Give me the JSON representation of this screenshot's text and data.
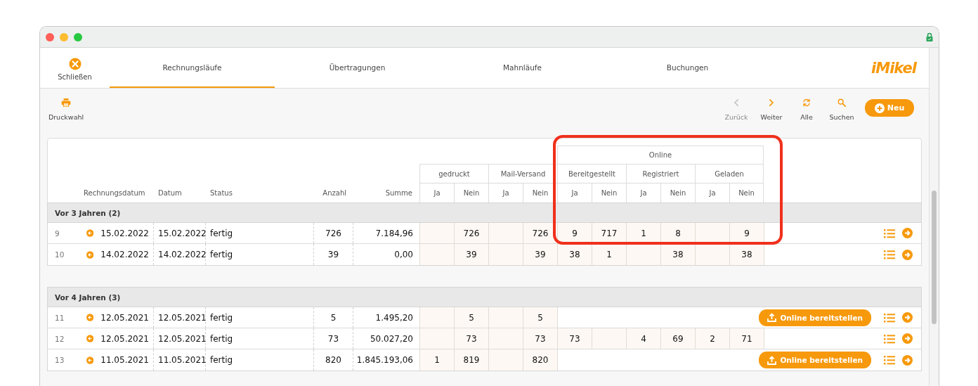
{
  "close": {
    "label": "Schließen"
  },
  "tabs": [
    {
      "label": "Rechnungsläufe",
      "selected": true
    },
    {
      "label": "Übertragungen",
      "selected": false
    },
    {
      "label": "Mahnläufe",
      "selected": false
    },
    {
      "label": "Buchungen",
      "selected": false
    }
  ],
  "logo": "iMikel",
  "toolbar": {
    "left": [
      {
        "kind": "print",
        "label": "Druckwahl"
      }
    ],
    "right": [
      {
        "kind": "back",
        "label": "Zurück",
        "disabled": true
      },
      {
        "kind": "forward",
        "label": "Weiter",
        "disabled": false
      },
      {
        "kind": "refresh",
        "label": "Alle",
        "disabled": false
      },
      {
        "kind": "search",
        "label": "Suchen",
        "disabled": false
      }
    ],
    "new_button": "Neu"
  },
  "table": {
    "columns": [
      "Rechnungsdatum",
      "Datum",
      "Status",
      "Anzahl",
      "Summe"
    ],
    "channels": [
      {
        "label": "gedruckt",
        "sub": [
          "Ja",
          "Nein"
        ]
      },
      {
        "label": "Mail-Versand",
        "sub": [
          "Ja",
          "Nein"
        ]
      }
    ],
    "online": {
      "label": "Online",
      "groups": [
        {
          "label": "Bereitgestellt",
          "sub": [
            "Ja",
            "Nein"
          ]
        },
        {
          "label": "Registriert",
          "sub": [
            "Ja",
            "Nein"
          ]
        },
        {
          "label": "Geladen",
          "sub": [
            "Ja",
            "Nein"
          ]
        }
      ]
    },
    "groups": [
      {
        "title": "Vor 3 Jahren (2)",
        "rows": [
          {
            "number": "9",
            "invoice_date": "15.02.2022",
            "date": "15.02.2022",
            "status": "fertig",
            "count": "726",
            "sum": "7.184,96",
            "kind": "online",
            "printed": {
              "no": "726"
            },
            "mail": {
              "no": "726"
            },
            "provided": {
              "yes": "9",
              "no": "717"
            },
            "registered": {
              "yes": "1",
              "no": "8"
            },
            "loaded": {
              "no": "9"
            }
          },
          {
            "number": "10",
            "invoice_date": "14.02.2022",
            "date": "14.02.2022",
            "status": "fertig",
            "count": "39",
            "sum": "0,00",
            "kind": "online",
            "printed": {
              "no": "39"
            },
            "mail": {
              "no": "39"
            },
            "provided": {
              "yes": "38",
              "no": "1"
            },
            "registered": {
              "no": "38"
            },
            "loaded": {
              "no": "38"
            }
          }
        ]
      },
      {
        "title": "Vor 4 Jahren (3)",
        "rows": [
          {
            "number": "11",
            "invoice_date": "12.05.2021",
            "date": "12.05.2021",
            "status": "fertig",
            "count": "5",
            "sum": "1.495,20",
            "kind": "pending",
            "printed": {
              "no": "5"
            },
            "mail": {
              "no": "5"
            },
            "action": "Online bereitstellen"
          },
          {
            "number": "12",
            "invoice_date": "12.05.2021",
            "date": "12.05.2021",
            "status": "fertig",
            "count": "73",
            "sum": "50.027,20",
            "kind": "online",
            "printed": {
              "no": "73"
            },
            "mail": {
              "no": "73"
            },
            "provided": {
              "yes": "73"
            },
            "registered": {
              "yes": "4",
              "no": "69"
            },
            "loaded": {
              "yes": "2",
              "no": "71"
            }
          },
          {
            "number": "13",
            "invoice_date": "11.05.2021",
            "date": "11.05.2021",
            "status": "fertig",
            "count": "820",
            "sum": "1.845.193,06",
            "kind": "pending",
            "printed": {
              "yes": "1",
              "no": "819"
            },
            "mail": {
              "no": "820"
            },
            "action": "Online bereitstellen"
          }
        ]
      }
    ]
  }
}
